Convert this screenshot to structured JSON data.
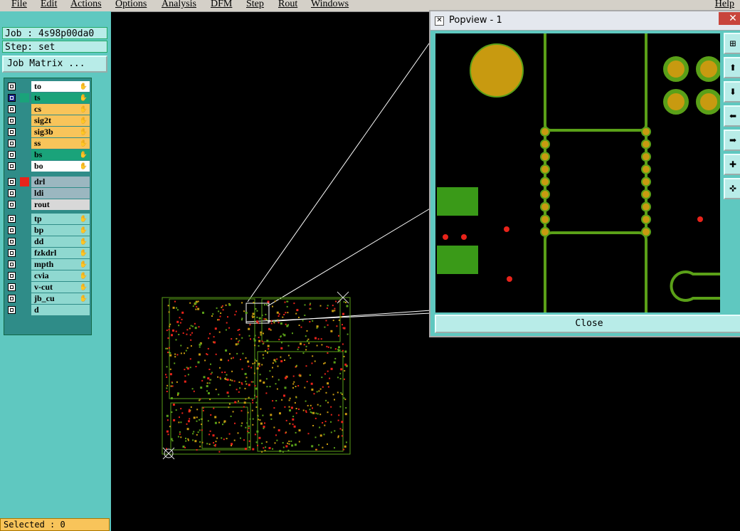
{
  "menu": [
    "File",
    "Edit",
    "Actions",
    "Options",
    "Analysis",
    "DFM",
    "Step",
    "Rout",
    "Windows"
  ],
  "menu_help": "Help",
  "job_label": "Job : 4s98p00da0",
  "step_label": "Step: set",
  "job_matrix_button": "Job Matrix ...",
  "layers_group1": [
    {
      "name": "to",
      "color": "#ffffff",
      "swatch": "",
      "checked": false
    },
    {
      "name": "ts",
      "color": "#1aa37a",
      "swatch": "#1aa37a",
      "checked": true
    },
    {
      "name": "cs",
      "color": "#f8c45a",
      "swatch": "",
      "checked": false
    },
    {
      "name": "sig2t",
      "color": "#f8c45a",
      "swatch": "",
      "checked": false
    },
    {
      "name": "sig3b",
      "color": "#f8c45a",
      "swatch": "",
      "checked": false
    },
    {
      "name": "ss",
      "color": "#f8c45a",
      "swatch": "",
      "checked": false
    },
    {
      "name": "bs",
      "color": "#1aa37a",
      "swatch": "",
      "checked": false
    },
    {
      "name": "bo",
      "color": "#ffffff",
      "swatch": "",
      "checked": false
    }
  ],
  "layers_group2": [
    {
      "name": "drl",
      "color": "#9bb7c0",
      "swatch": "#e8231a",
      "checked": false
    },
    {
      "name": "ldi",
      "color": "#9bb7c0",
      "swatch": "",
      "checked": false
    },
    {
      "name": "rout",
      "color": "#d8d8d8",
      "swatch": "",
      "checked": false
    }
  ],
  "layers_group3": [
    {
      "name": "tp",
      "color": "#8fd8d0",
      "swatch": "",
      "checked": false
    },
    {
      "name": "bp",
      "color": "#8fd8d0",
      "swatch": "",
      "checked": false
    },
    {
      "name": "dd",
      "color": "#8fd8d0",
      "swatch": "",
      "checked": false
    },
    {
      "name": "fzkdrl",
      "color": "#8fd8d0",
      "swatch": "",
      "checked": false
    },
    {
      "name": "mpth",
      "color": "#8fd8d0",
      "swatch": "",
      "checked": false
    },
    {
      "name": "cvia",
      "color": "#8fd8d0",
      "swatch": "",
      "checked": false
    },
    {
      "name": "v-cut",
      "color": "#8fd8d0",
      "swatch": "",
      "checked": false
    },
    {
      "name": "jb_cu",
      "color": "#8fd8d0",
      "swatch": "",
      "checked": false
    },
    {
      "name": "d",
      "color": "#8fd8d0",
      "swatch": "",
      "checked": false
    }
  ],
  "status_text": "Selected : 0",
  "popup": {
    "title": "Popview - 1",
    "close_x": "✕",
    "close_button": "Close"
  },
  "colors": {
    "panel": "#5fc8c0",
    "copper": "#c89a10",
    "trace": "#5aa018",
    "drill": "#e8231a"
  }
}
